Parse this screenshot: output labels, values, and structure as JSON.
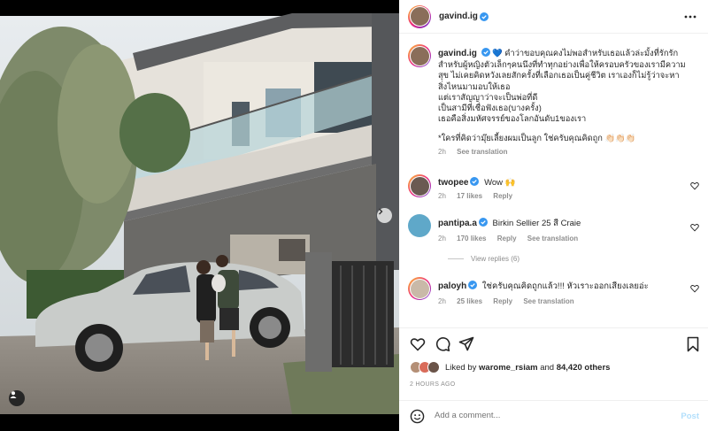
{
  "post": {
    "username": "gavind.ig",
    "caption_lines": [
      "คำว่าขอบคุณคงไม่พอสำหรับเธอแล้วล่ะมั้งที่รักรัก",
      "สำหรับผู้หญิงตัวเล็กๆคนนึงที่ทำทุกอย่างเพื่อให้ครอบครัวของเรามีความ",
      "สุข ไม่เคยคิดหวังเลยสักครั้งที่เลือกเธอเป็นคู่ชีวิต เราเองก็ไม่รู้ว่าจะหา",
      "สิ่งไหนมามอบให้เธอ",
      "แต่เราสัญญาว่าจะเป็นพ่อที่ดี",
      "เป็นสามีที่เชื่อฟังเธอ(บางครั้ง)",
      "เธอคือสิ่งมหัศจรรย์ของโลกอันดับ1ของเรา"
    ],
    "caption_note": "*ใครที่คิดว่ามุ๊ยเลี้ยงผมเป็นลูก ใช่ครับคุณคิดถูก 👏🏻👏🏻👏🏻",
    "caption_time": "2h",
    "see_translation": "See translation",
    "likes_by": "warome_rsiam",
    "likes_others": "84,420 others",
    "likes_prefix": "Liked by",
    "likes_and": "and",
    "time_ago": "2 HOURS AGO",
    "comment_placeholder": "Add a comment...",
    "post_label": "Post"
  },
  "comments": [
    {
      "user": "twopee",
      "verified": true,
      "text": "Wow 🙌",
      "time": "2h",
      "likes": "17 likes",
      "reply": "Reply",
      "translate": ""
    },
    {
      "user": "pantipa.a",
      "verified": true,
      "text": "Birkin Sellier 25 สี Craie",
      "time": "2h",
      "likes": "170 likes",
      "reply": "Reply",
      "translate": "See translation"
    },
    {
      "user": "paloyh",
      "verified": true,
      "text": "ใช่ครับคุณคิดถูกแล้ว!!! หัวเราะออกเสียงเลยอ่ะ",
      "time": "2h",
      "likes": "25 likes",
      "reply": "Reply",
      "translate": "See translation"
    }
  ],
  "view_replies": "View replies (6)",
  "colors": {
    "verified": "#3897f0",
    "link_blue": "#b2dffc",
    "muted": "#8e8e8e",
    "text": "#262626"
  }
}
